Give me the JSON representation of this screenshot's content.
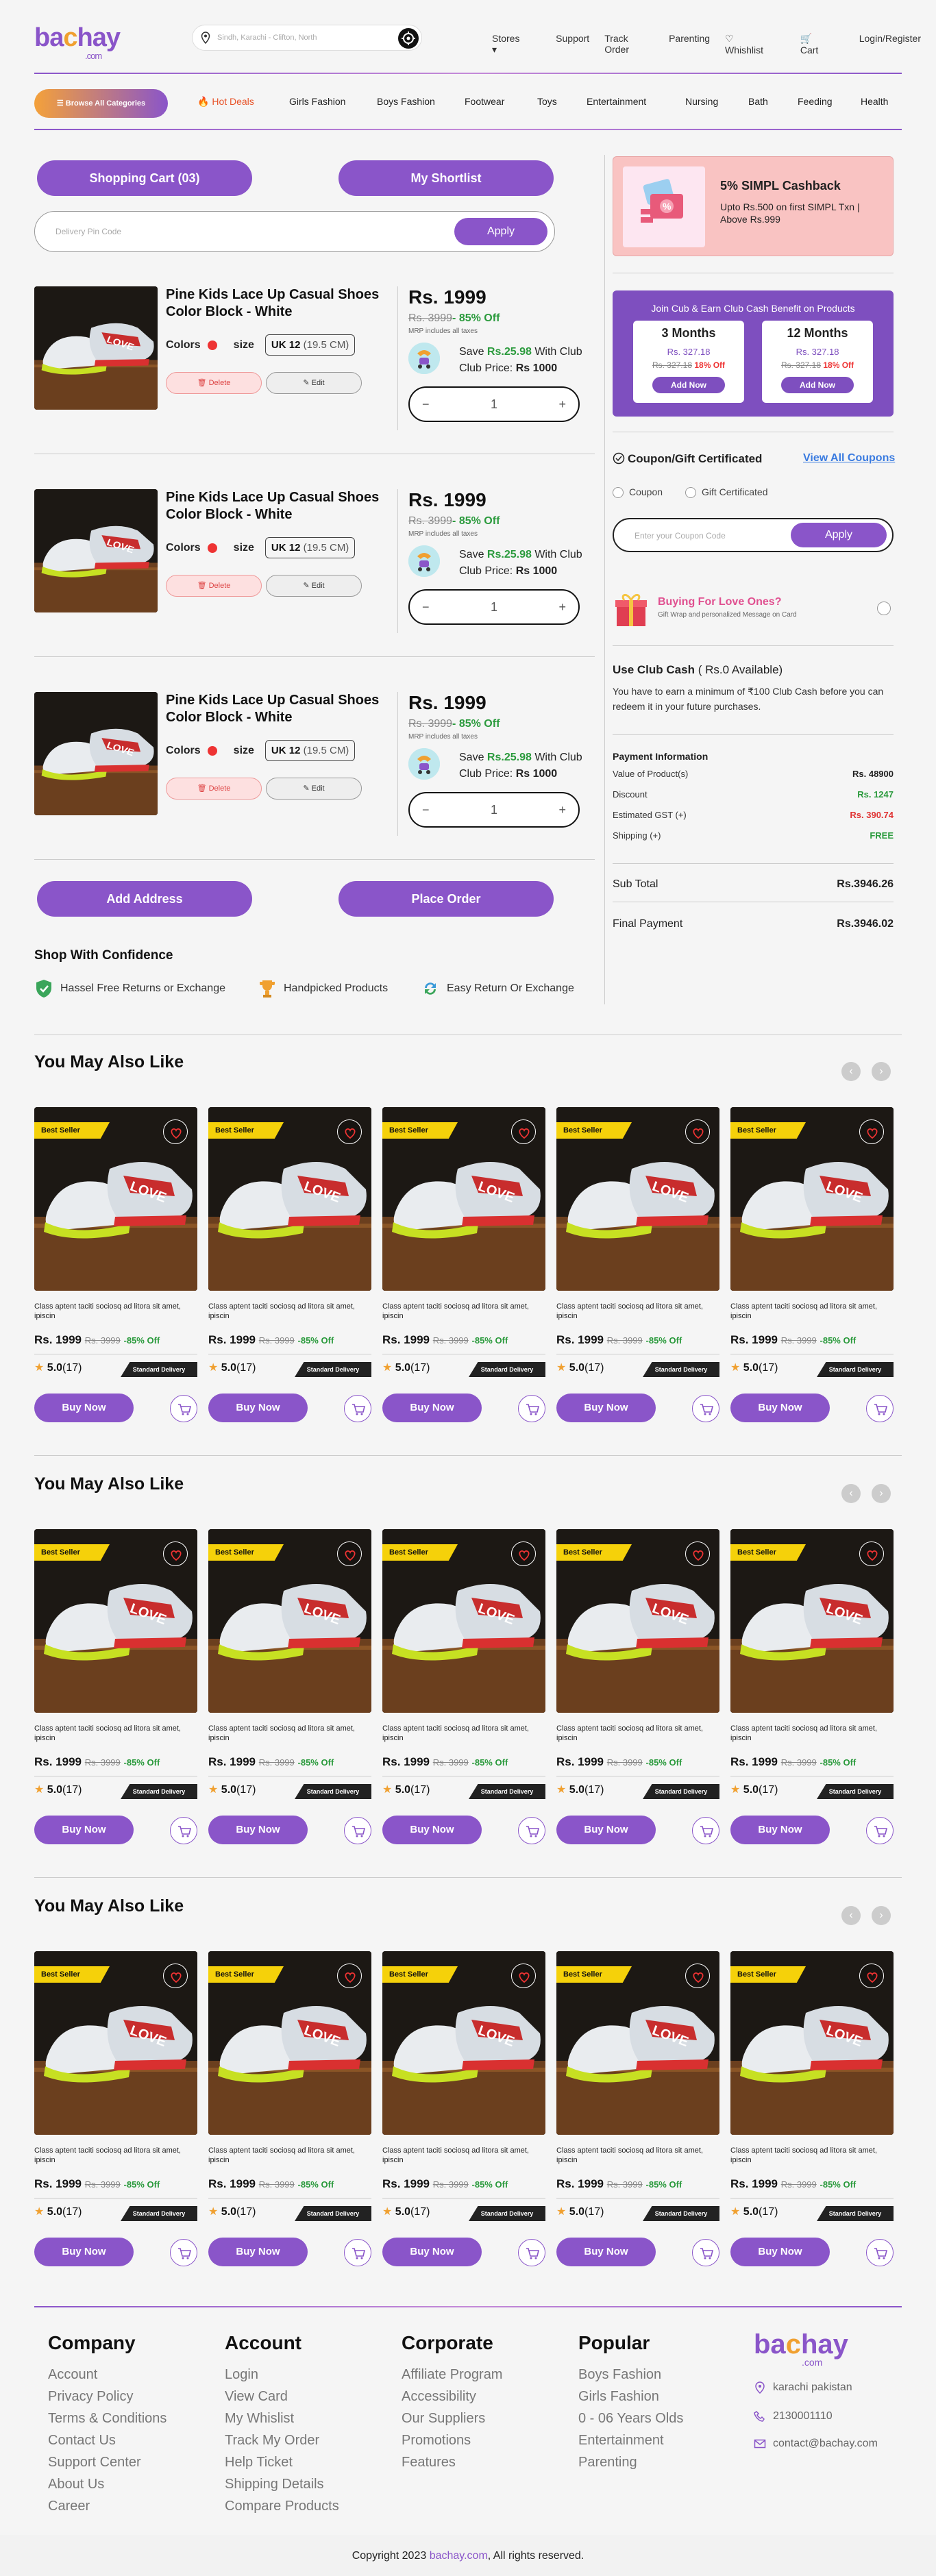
{
  "header": {
    "logo_main": "bachay",
    "logo_sub": ".com",
    "search_placeholder": "Sindh, Karachi - Clifton, North",
    "nav": [
      "Stores",
      "Support",
      "Track Order",
      "Parenting",
      "Whishlist",
      "Cart",
      "Login/Register"
    ]
  },
  "categories": {
    "browse_label": "Browse All Categories",
    "items": [
      "Hot Deals",
      "Girls Fashion",
      "Boys Fashion",
      "Footwear",
      "Toys",
      "Entertainment",
      "Nursing",
      "Bath",
      "Feeding",
      "Health"
    ]
  },
  "cart": {
    "cart_button": "Shopping Cart (03)",
    "shortlist_button": "My Shortlist",
    "pin_placeholder": "Delivery Pin Code",
    "apply_label": "Apply",
    "items": [
      {
        "name": "Pine Kids Lace Up Casual Shoes Color Block - White",
        "colors_label": "Colors",
        "size_label": "size",
        "size": "UK 12",
        "size_cm": "(19.5 CM)",
        "delete": "Delete",
        "edit": "Edit",
        "price": "Rs. 1999",
        "old_price": "Rs. 3999",
        "discount": "- 85% Off",
        "mrp": "MRP includes all taxes",
        "save_label": "Save",
        "save_amount": "Rs.25.98",
        "save_with": "With Club",
        "club_label": "Club Price:",
        "club_price": "Rs 1000",
        "qty": "1"
      },
      {
        "name": "Pine Kids Lace Up Casual Shoes Color Block - White",
        "colors_label": "Colors",
        "size_label": "size",
        "size": "UK 12",
        "size_cm": "(19.5 CM)",
        "delete": "Delete",
        "edit": "Edit",
        "price": "Rs. 1999",
        "old_price": "Rs. 3999",
        "discount": "- 85% Off",
        "mrp": "MRP includes all taxes",
        "save_label": "Save",
        "save_amount": "Rs.25.98",
        "save_with": "With Club",
        "club_label": "Club Price:",
        "club_price": "Rs 1000",
        "qty": "1"
      },
      {
        "name": "Pine Kids Lace Up Casual Shoes Color Block - White",
        "colors_label": "Colors",
        "size_label": "size",
        "size": "UK 12",
        "size_cm": "(19.5 CM)",
        "delete": "Delete",
        "edit": "Edit",
        "price": "Rs. 1999",
        "old_price": "Rs. 3999",
        "discount": "- 85% Off",
        "mrp": "MRP includes all taxes",
        "save_label": "Save",
        "save_amount": "Rs.25.98",
        "save_with": "With Club",
        "club_label": "Club Price:",
        "club_price": "Rs 1000",
        "qty": "1"
      }
    ],
    "add_address": "Add Address",
    "place_order": "Place Order"
  },
  "confidence": {
    "title": "Shop With Confidence",
    "items": [
      "Hassel Free Returns or Exchange",
      "Handpicked Products",
      "Easy Return Or Exchange"
    ]
  },
  "sidebar": {
    "simpl_title": "5% SIMPL Cashback",
    "simpl_text": "Upto Rs.500 on first SIMPL Txn | Above Rs.999",
    "club_title": "Join Cub & Earn Club Cash Benefit on Products",
    "plans": [
      {
        "months": "3 Months",
        "price": "Rs. 327.18",
        "old": "Rs. 327.18",
        "off": "18% Off",
        "add": "Add Now"
      },
      {
        "months": "12 Months",
        "price": "Rs. 327.18",
        "old": "Rs. 327.18",
        "off": "18% Off",
        "add": "Add Now"
      }
    ],
    "coupon_title": "Coupon/Gift Certificated",
    "view_all": "View All Coupons",
    "coupon_option": "Coupon",
    "gift_option": "Gift Certificated",
    "coupon_placeholder": "Enter your Coupon Code",
    "coupon_apply": "Apply",
    "gift_title": "Buying For Love Ones?",
    "gift_text": "Gift Wrap and personalized Message on Card",
    "use_club": "Use Club Cash",
    "use_club_avail": "( Rs.0 Available)",
    "club_text": "You have to earn a minimum of ₹100 Club Cash before you can redeem it in your future purchases.",
    "payment_title": "Payment Information",
    "payments": [
      {
        "label": "Value of Product(s)",
        "value": "Rs. 48900",
        "color": "#222222"
      },
      {
        "label": "Discount",
        "value": "Rs. 1247",
        "color": "#2a9a3c"
      },
      {
        "label": "Estimated GST (+)",
        "value": "Rs. 390.74",
        "color": "#e03333"
      },
      {
        "label": "Shipping (+)",
        "value": "FREE",
        "color": "#2a9a3c"
      }
    ],
    "subtotal_label": "Sub Total",
    "subtotal": "Rs.3946.26",
    "final_label": "Final Payment",
    "final": "Rs.3946.02"
  },
  "recommendations": {
    "title": "You May Also Like",
    "card": {
      "badge": "Best Seller",
      "desc": "Class aptent taciti sociosq ad litora sit amet, ipiscin",
      "price": "Rs. 1999",
      "old": "Rs. 3999",
      "off": "-85% Off",
      "rating": "5.0",
      "reviews": "(17)",
      "delivery": "Standard Delivery",
      "buy": "Buy Now"
    }
  },
  "footer": {
    "columns": [
      {
        "title": "Company",
        "links": [
          "Account",
          "Privacy Policy",
          "Terms & Conditions",
          "Contact Us",
          "Support Center",
          "About Us",
          "Career"
        ]
      },
      {
        "title": "Account",
        "links": [
          "Login",
          "View Card",
          "My Whislist",
          "Track My Order",
          "Help Ticket",
          "Shipping Details",
          "Compare Products"
        ]
      },
      {
        "title": "Corporate",
        "links": [
          "Affiliate Program",
          "Accessibility",
          "Our Suppliers",
          "Promotions",
          "Features"
        ]
      },
      {
        "title": "Popular",
        "links": [
          "Boys Fashion",
          "Girls Fashion",
          "0 - 06 Years Olds",
          "Entertainment",
          "Parenting"
        ]
      }
    ],
    "address": "karachi pakistan",
    "phone": "2130001110",
    "email": "contact@bachay.com",
    "copy_prefix": "Copyright 2023",
    "copy_site": "bachay.com",
    "copy_suffix": ", All rights reserved."
  }
}
